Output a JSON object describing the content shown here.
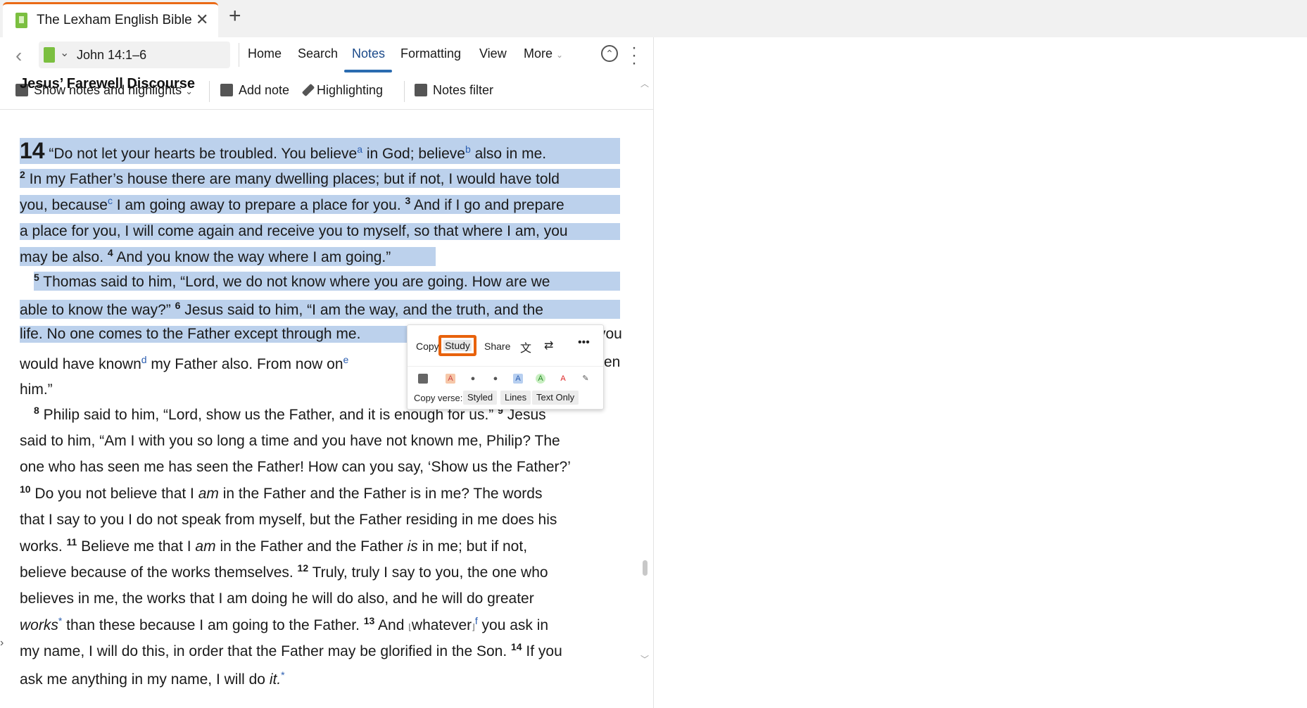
{
  "tab": {
    "title": "The Lexham English Bible",
    "close": "✕",
    "new": "+"
  },
  "nav": {
    "reference": "John 14:1–6",
    "menus": [
      "Home",
      "Search",
      "Notes",
      "Formatting",
      "View",
      "More"
    ],
    "active_menu": "Notes"
  },
  "toolbar": {
    "show_notes": "Show notes and highlights",
    "add_note": "Add note",
    "highlighting": "Highlighting",
    "notes_filter": "Notes filter"
  },
  "heading": "Jesus’ Farewell Discourse",
  "text": {
    "l1": [
      "14",
      " “Do not let your hearts be troubled. You believe",
      "a",
      " in God; believe",
      "b",
      " also in me."
    ],
    "l2": [
      "2",
      " In my Father’s house there are many dwelling places; but if not, I would have told"
    ],
    "l3": [
      " you, because",
      "c",
      " I am going away to prepare a place for you. ",
      "3",
      " And if I go and prepare"
    ],
    "l4": "a place for you, I will come again and receive you to myself, so that where I am, you",
    "l5": [
      "may be also. ",
      "4",
      " And you know the way where I am going.”"
    ],
    "l6": [
      "5",
      " Thomas said to him, “Lord, we do not know where you are going. How are we"
    ],
    "l7": [
      "able to know the way?” ",
      "6",
      " Jesus said to him, “I am the way, and the truth, and the"
    ],
    "l8a": "life. No one comes to the Father except through me.",
    "l8b": "you",
    "l9a": [
      "would have known",
      "d",
      " my Father also. From now on",
      "e"
    ],
    "l9b": "en",
    "l10": "him.”",
    "l11": [
      "8",
      " Philip said to him, “Lord, show us the Father, and it is enough for us.” ",
      "9",
      " Jesus"
    ],
    "l12": "said to him, “Am I with you so long a time and you have not known me, Philip? The",
    "l13": "one who has seen me has seen the Father! How can you say, ‘Show us the Father?’",
    "l14": [
      "10",
      " Do you not believe that I ",
      "am",
      " in the Father and the Father is in me? The words"
    ],
    "l15": "that I say to you I do not speak from myself, but the Father residing in me does his",
    "l16": [
      "works. ",
      "11",
      " Believe me that I ",
      "am",
      " in the Father and the Father ",
      "is",
      " in me; but if not,"
    ],
    "l17": [
      "believe because of the works themselves. ",
      "12",
      " Truly, truly I say to you, the one who"
    ],
    "l18": "believes in me, the works that I am doing he will do also, and he will do greater",
    "l19": [
      "works",
      "*",
      " than these because I am going to the Father. ",
      "13",
      " And ",
      "⌊",
      "whatever",
      "⌋",
      "f",
      " you ask in"
    ],
    "l20": [
      "my name, I will do this, in order that the Father may be glorified in the Son. ",
      "14",
      " If you"
    ],
    "l21": [
      "ask me anything in my name, I will do ",
      "it.",
      "*"
    ]
  },
  "popup": {
    "copy": "Copy",
    "study": "Study",
    "share": "Share",
    "copy_verse_label": "Copy verse:",
    "copy_options": [
      "Styled",
      "Lines",
      "Text Only"
    ]
  },
  "colors": {
    "accent": "#ea6a16",
    "highlight": "#bcd1ec",
    "link": "#2a5db0",
    "study_border": "#e8620c"
  }
}
